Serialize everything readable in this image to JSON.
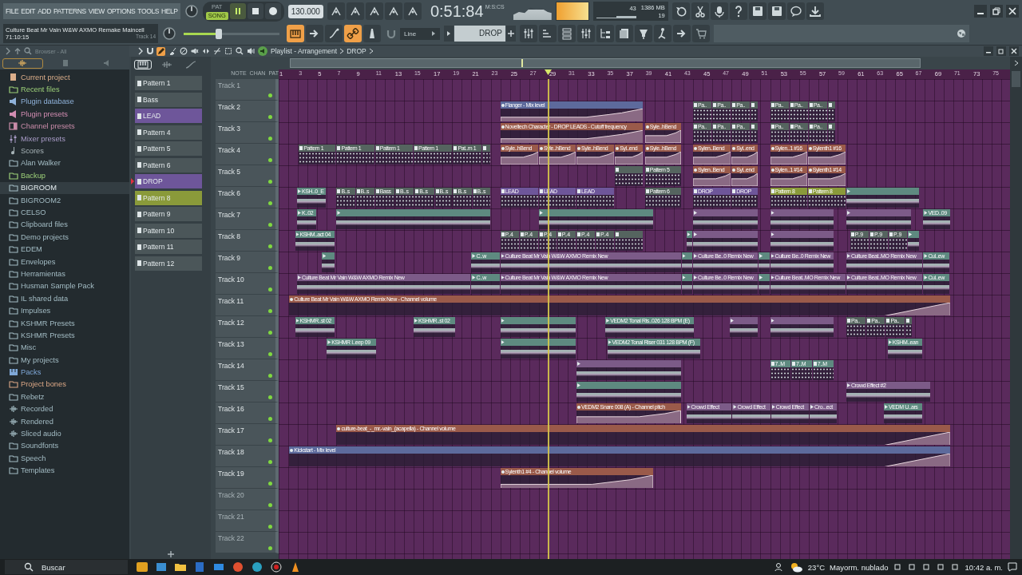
{
  "window": {
    "menu": [
      "FILE",
      "EDIT",
      "ADD",
      "PATTERNS",
      "VIEW",
      "OPTIONS",
      "TOOLS",
      "HELP"
    ],
    "project": {
      "title": "Culture Beat  Mr Vain W&W AXMO Remake Maincell",
      "time": "71:10:15",
      "hint": "Track 14"
    },
    "transport": {
      "modes": [
        {
          "label": "PAT",
          "selected": false
        },
        {
          "label": "SONG",
          "selected": true
        }
      ],
      "playing": true,
      "tempo": "130.000",
      "time": "0:51:84",
      "time_unit": "M:S:CS"
    },
    "meters": {
      "cpu": "43",
      "memory": "1386 MB",
      "polyphony": "19"
    },
    "master_volume": {
      "level": 0.37
    },
    "snap": "Line",
    "pattern": "DROP",
    "toggles": [
      {
        "kind": "playlist",
        "on": true
      },
      {
        "kind": "arrow",
        "on": false
      },
      {
        "kind": "curve",
        "on": false
      },
      {
        "kind": "link",
        "on": true
      },
      {
        "kind": "metronome",
        "on": false
      }
    ]
  },
  "browser": {
    "title": "Browser - All",
    "tabs": [
      {
        "kind": "all",
        "selected": true
      },
      {
        "kind": "files",
        "selected": false
      },
      {
        "kind": "plugins",
        "selected": false
      }
    ],
    "items": [
      {
        "label": "Current project",
        "kind": "project",
        "selected": false
      },
      {
        "label": "Recent files",
        "kind": "recent",
        "selected": false
      },
      {
        "label": "Plugin database",
        "kind": "plugin",
        "selected": false
      },
      {
        "label": "Plugin presets",
        "kind": "plugin_presets",
        "selected": false
      },
      {
        "label": "Channel presets",
        "kind": "channel",
        "selected": false
      },
      {
        "label": "Mixer presets",
        "kind": "mixer",
        "selected": false
      },
      {
        "label": "Scores",
        "kind": "scores",
        "selected": false
      },
      {
        "label": "Alan Walker",
        "kind": "folder",
        "selected": false
      },
      {
        "label": "Backup",
        "kind": "recent",
        "selected": false
      },
      {
        "label": "BIGROOM",
        "kind": "folder",
        "selected": true
      },
      {
        "label": "BIGROOM2",
        "kind": "folder",
        "selected": false
      },
      {
        "label": "CELSO",
        "kind": "folder",
        "selected": false
      },
      {
        "label": "Clipboard files",
        "kind": "folder",
        "selected": false
      },
      {
        "label": "Demo projects",
        "kind": "folder",
        "selected": false
      },
      {
        "label": "EDEM",
        "kind": "folder",
        "selected": false
      },
      {
        "label": "Envelopes",
        "kind": "folder",
        "selected": false
      },
      {
        "label": "Herramientas",
        "kind": "folder",
        "selected": false
      },
      {
        "label": "Husman Sample Pack",
        "kind": "folder",
        "selected": false
      },
      {
        "label": "IL shared data",
        "kind": "folder",
        "selected": false
      },
      {
        "label": "Impulses",
        "kind": "folder",
        "selected": false
      },
      {
        "label": "KSHMR Presets",
        "kind": "folder",
        "selected": false
      },
      {
        "label": "KSHMR Presets",
        "kind": "folder",
        "selected": false
      },
      {
        "label": "Misc",
        "kind": "folder",
        "selected": false
      },
      {
        "label": "My projects",
        "kind": "folder",
        "selected": false
      },
      {
        "label": "Packs",
        "kind": "packs",
        "selected": false
      },
      {
        "label": "Project bones",
        "kind": "bones",
        "selected": false
      },
      {
        "label": "Rebetz",
        "kind": "folder",
        "selected": false
      },
      {
        "label": "Recorded",
        "kind": "audio",
        "selected": false
      },
      {
        "label": "Rendered",
        "kind": "audio",
        "selected": false
      },
      {
        "label": "Sliced audio",
        "kind": "audio",
        "selected": false
      },
      {
        "label": "Soundfonts",
        "kind": "folder",
        "selected": false
      },
      {
        "label": "Speech",
        "kind": "folder",
        "selected": false
      },
      {
        "label": "Templates",
        "kind": "folder",
        "selected": false
      }
    ]
  },
  "playlist": {
    "title": "Playlist - Arrangement",
    "pattern": "DROP",
    "tools": [
      {
        "kind": "draw",
        "selected": true
      },
      {
        "kind": "paint",
        "selected": false
      },
      {
        "kind": "delete",
        "selected": false
      },
      {
        "kind": "mute",
        "selected": false
      },
      {
        "kind": "slip",
        "selected": false
      },
      {
        "kind": "slice",
        "selected": false
      },
      {
        "kind": "select",
        "selected": false
      },
      {
        "kind": "zoom",
        "selected": false
      },
      {
        "kind": "playback",
        "selected": false
      }
    ],
    "picker_tabs": [
      {
        "kind": "patterns",
        "selected": true
      },
      {
        "kind": "audio",
        "selected": false
      },
      {
        "kind": "automation",
        "selected": false
      }
    ],
    "header_tabs": [
      "NOTE",
      "CHAN",
      "PAT"
    ],
    "ruler": [
      "1",
      "3",
      "5",
      "7",
      "9",
      "11",
      "13",
      "15",
      "17",
      "19",
      "21",
      "23",
      "25",
      "27",
      "29",
      "31",
      "33",
      "35",
      "37",
      "39",
      "41",
      "43",
      "45",
      "47",
      "49",
      "51",
      "53",
      "55",
      "57",
      "59",
      "61",
      "63",
      "65",
      "67",
      "69",
      "71",
      "73",
      "75"
    ],
    "patterns": [
      {
        "label": "Pattern 1",
        "color": "#4b5659",
        "selected": false
      },
      {
        "label": "Bass",
        "color": "#4b5659",
        "selected": false
      },
      {
        "label": "LEAD",
        "color": "#6e569a",
        "selected": false
      },
      {
        "label": "Pattern 4",
        "color": "#4b5659",
        "selected": false
      },
      {
        "label": "Pattern 5",
        "color": "#4b5659",
        "selected": false
      },
      {
        "label": "Pattern 6",
        "color": "#4b5659",
        "selected": false
      },
      {
        "label": "DROP",
        "color": "#6e569a",
        "selected": true
      },
      {
        "label": "Pattern 8",
        "color": "#8a9a3a",
        "selected": false
      },
      {
        "label": "Pattern 9",
        "color": "#4b5659",
        "selected": false
      },
      {
        "label": "Pattern 10",
        "color": "#4b5659",
        "selected": false
      },
      {
        "label": "Pattern 11",
        "color": "#4b5659",
        "selected": false
      },
      {
        "label": "Pattern 12",
        "color": "#4b5659",
        "selected": false
      }
    ],
    "tracks": [
      {
        "name": "Track 1",
        "empty": true,
        "active": true
      },
      {
        "name": "Track 2",
        "empty": false,
        "active": true,
        "clips": [
          {
            "kind": "auto",
            "label": "Flanger - Mix level",
            "color": "#5d6a9c"
          },
          {
            "kind": "pattern",
            "label": "Pa..",
            "color": "#55645f"
          },
          {
            "kind": "pattern",
            "label": "Pa..",
            "color": "#55645f"
          },
          {
            "kind": "pattern",
            "label": "Pa..",
            "color": "#55645f"
          },
          {
            "kind": "pattern",
            "color": "#55645f"
          },
          {
            "kind": "pattern",
            "label": "Pa..",
            "color": "#55645f"
          },
          {
            "kind": "pattern",
            "label": "Pa..",
            "color": "#55645f"
          },
          {
            "kind": "pattern",
            "label": "Pa..",
            "color": "#55645f"
          },
          {
            "kind": "pattern",
            "color": "#55645f"
          }
        ]
      },
      {
        "name": "Track 3",
        "empty": false,
        "active": true,
        "clips": [
          {
            "kind": "auto",
            "label": "Noveltech Character - DROP  LEADS - Cutoff frequency",
            "color": "#9a5a4a"
          },
          {
            "kind": "auto",
            "label": "Syle..hBend",
            "color": "#9a5a4a"
          },
          {
            "kind": "pattern",
            "label": "Pa..",
            "color": "#55645f"
          },
          {
            "kind": "pattern",
            "label": "Pa..",
            "color": "#55645f"
          },
          {
            "kind": "pattern",
            "label": "Pa..",
            "color": "#55645f"
          },
          {
            "kind": "pattern",
            "color": "#55645f"
          },
          {
            "kind": "pattern",
            "label": "Pa..",
            "color": "#55645f"
          },
          {
            "kind": "pattern",
            "label": "Pa..",
            "color": "#55645f"
          },
          {
            "kind": "pattern",
            "label": "Pa..",
            "color": "#55645f"
          },
          {
            "kind": "pattern",
            "color": "#55645f"
          }
        ]
      },
      {
        "name": "Track 4",
        "empty": false,
        "active": true,
        "clips": [
          {
            "kind": "pattern",
            "label": "Pattern 1",
            "color": "#55645f"
          },
          {
            "kind": "pattern",
            "label": "Pattern 1",
            "color": "#55645f"
          },
          {
            "kind": "pattern",
            "label": "Pattern 1",
            "color": "#55645f"
          },
          {
            "kind": "pattern",
            "label": "Pattern 1",
            "color": "#55645f"
          },
          {
            "kind": "pattern",
            "label": "Pat..rn 1",
            "color": "#55645f"
          },
          {
            "kind": "pattern",
            "color": "#55645f"
          },
          {
            "kind": "auto",
            "label": "Syle..hBend",
            "color": "#9a5a4a"
          },
          {
            "kind": "auto",
            "label": "Syle..hBend",
            "color": "#9a5a4a"
          },
          {
            "kind": "auto",
            "label": "Syle..hBend",
            "color": "#9a5a4a"
          },
          {
            "kind": "auto",
            "label": "Syl..end",
            "color": "#9a5a4a"
          },
          {
            "kind": "auto",
            "label": "Syle..hBend",
            "color": "#9a5a4a"
          },
          {
            "kind": "auto",
            "label": "Sylen..Bend",
            "color": "#9a5a4a"
          },
          {
            "kind": "auto",
            "label": "Syl..end",
            "color": "#9a5a4a"
          },
          {
            "kind": "auto",
            "label": "Sylen..1 #16",
            "color": "#9a5a4a"
          },
          {
            "kind": "auto",
            "label": "Sylenth1 #16",
            "color": "#9a5a4a"
          }
        ]
      },
      {
        "name": "Track 5",
        "empty": false,
        "active": true,
        "clips": [
          {
            "kind": "pattern",
            "color": "#55645f"
          },
          {
            "kind": "pattern",
            "label": "Pattern 5",
            "color": "#55645f"
          },
          {
            "kind": "auto",
            "label": "Sylen..Bend",
            "color": "#9a5a4a"
          },
          {
            "kind": "auto",
            "label": "Syl..end",
            "color": "#9a5a4a"
          },
          {
            "kind": "auto",
            "label": "Sylen..1 #14",
            "color": "#9a5a4a"
          },
          {
            "kind": "auto",
            "label": "Sylenth1 #14",
            "color": "#9a5a4a"
          }
        ]
      },
      {
        "name": "Track 6",
        "empty": false,
        "active": true,
        "clips": [
          {
            "kind": "audio",
            "label": "KSH..0_E",
            "color": "#5e8a80"
          },
          {
            "kind": "pattern",
            "label": "B..s",
            "color": "#55645f"
          },
          {
            "kind": "pattern",
            "label": "B..s",
            "color": "#55645f"
          },
          {
            "kind": "pattern",
            "label": "Bass",
            "color": "#55645f"
          },
          {
            "kind": "pattern",
            "label": "B..s",
            "color": "#55645f"
          },
          {
            "kind": "pattern",
            "label": "B..s",
            "color": "#55645f"
          },
          {
            "kind": "pattern",
            "label": "B..s",
            "color": "#55645f"
          },
          {
            "kind": "pattern",
            "label": "B..s",
            "color": "#55645f"
          },
          {
            "kind": "pattern",
            "label": "B..s",
            "color": "#55645f"
          },
          {
            "kind": "pattern",
            "label": "LEAD",
            "color": "#6e569a"
          },
          {
            "kind": "pattern",
            "label": "LEAD",
            "color": "#6e569a"
          },
          {
            "kind": "pattern",
            "label": "LEAD",
            "color": "#6e569a"
          },
          {
            "kind": "pattern",
            "label": "Pattern 6",
            "color": "#55645f"
          },
          {
            "kind": "pattern",
            "label": "DROP",
            "color": "#6e569a"
          },
          {
            "kind": "pattern",
            "label": "DROP",
            "color": "#6e569a"
          },
          {
            "kind": "pattern",
            "label": "Pattern 8",
            "color": "#8a9a3a"
          },
          {
            "kind": "pattern",
            "label": "Pattern 8",
            "color": "#8a9a3a"
          },
          {
            "kind": "audio",
            "color": "#5e8a80"
          }
        ]
      },
      {
        "name": "Track 7",
        "empty": false,
        "active": true,
        "clips": [
          {
            "kind": "audio",
            "label": "K..02",
            "color": "#5e8a80"
          },
          {
            "kind": "audio",
            "color": "#5e8a80"
          },
          {
            "kind": "audio",
            "color": "#5e8a80"
          },
          {
            "kind": "audio",
            "color": "#7c5b88"
          },
          {
            "kind": "audio",
            "color": "#7c5b88"
          },
          {
            "kind": "audio",
            "color": "#7c5b88"
          },
          {
            "kind": "audio",
            "label": "VED..09",
            "color": "#5e8a80"
          }
        ]
      },
      {
        "name": "Track 8",
        "empty": false,
        "active": true,
        "clips": [
          {
            "kind": "audio",
            "label": "KSHM..act 04",
            "color": "#5e8a80"
          },
          {
            "kind": "pattern",
            "label": "P..4",
            "color": "#55645f"
          },
          {
            "kind": "pattern",
            "label": "P..4",
            "color": "#55645f"
          },
          {
            "kind": "pattern",
            "label": "P..4",
            "color": "#55645f"
          },
          {
            "kind": "pattern",
            "label": "P..4",
            "color": "#55645f"
          },
          {
            "kind": "pattern",
            "label": "P..4",
            "color": "#55645f"
          },
          {
            "kind": "pattern",
            "label": "P..4",
            "color": "#55645f"
          },
          {
            "kind": "pattern",
            "color": "#55645f"
          },
          {
            "kind": "audio",
            "color": "#5e8a80"
          },
          {
            "kind": "audio",
            "color": "#7c5b88"
          },
          {
            "kind": "audio",
            "color": "#7c5b88"
          },
          {
            "kind": "pattern",
            "label": "P..9",
            "color": "#55645f"
          },
          {
            "kind": "pattern",
            "label": "P..9",
            "color": "#55645f"
          },
          {
            "kind": "pattern",
            "label": "P..9",
            "color": "#55645f"
          },
          {
            "kind": "audio",
            "color": "#5e8a80"
          }
        ]
      },
      {
        "name": "Track 9",
        "empty": false,
        "active": true,
        "clips": [
          {
            "kind": "audio",
            "color": "#5e8a80"
          },
          {
            "kind": "audio",
            "label": "C..w",
            "color": "#5e8a80"
          },
          {
            "kind": "audio",
            "label": "Culture Beat  Mr Vain W&W  AXMO Remix New",
            "color": "#7c5b88"
          },
          {
            "kind": "audio",
            "color": "#5e8a80"
          },
          {
            "kind": "audio",
            "label": "Culture Be..0 Remix New",
            "color": "#7c5b88"
          },
          {
            "kind": "audio",
            "color": "#5e8a80"
          },
          {
            "kind": "audio",
            "label": "Culture Be..0 Remix New",
            "color": "#7c5b88"
          },
          {
            "kind": "audio",
            "label": "Culture Beat..MO Remix New",
            "color": "#7c5b88"
          },
          {
            "kind": "audio",
            "label": "Cul..ew",
            "color": "#5e8a80"
          }
        ]
      },
      {
        "name": "Track 10",
        "empty": false,
        "active": true,
        "clips": [
          {
            "kind": "audio",
            "label": "Culture Beat  Mr Vain W&W  AXMO Remix New",
            "color": "#7c5b88"
          },
          {
            "kind": "audio",
            "label": "C..w",
            "color": "#5e8a80"
          },
          {
            "kind": "audio",
            "label": "Culture Beat  Mr Vain W&W  AXMO Remix New",
            "color": "#7c5b88"
          },
          {
            "kind": "audio",
            "color": "#5e8a80"
          },
          {
            "kind": "audio",
            "label": "Culture Be..0 Remix New",
            "color": "#7c5b88"
          },
          {
            "kind": "audio",
            "color": "#5e8a80"
          },
          {
            "kind": "audio",
            "label": "Culture Beat..MO Remix New",
            "color": "#7c5b88"
          },
          {
            "kind": "audio",
            "label": "Culture Beat..MO Remix New",
            "color": "#7c5b88"
          },
          {
            "kind": "audio",
            "label": "Cul..ew",
            "color": "#5e8a80"
          }
        ]
      },
      {
        "name": "Track 11",
        "empty": false,
        "active": true,
        "clips": [
          {
            "kind": "auto",
            "label": "Culture Beat  Mr Vain W&W  AXMO Remix New - Channel volume",
            "color": "#9a5a4a"
          }
        ]
      },
      {
        "name": "Track 12",
        "empty": false,
        "active": true,
        "clips": [
          {
            "kind": "audio",
            "label": "KSHMR..st 02",
            "color": "#5e8a80"
          },
          {
            "kind": "audio",
            "label": "KSHMR..st 02",
            "color": "#5e8a80"
          },
          {
            "kind": "audio",
            "color": "#5e8a80"
          },
          {
            "kind": "audio",
            "label": "VEDM2 Tonal Ris..026 128 BPM (E)",
            "color": "#5e8a80"
          },
          {
            "kind": "audio",
            "color": "#7c5b88"
          },
          {
            "kind": "audio",
            "color": "#7c5b88"
          },
          {
            "kind": "pattern",
            "label": "Pa..",
            "color": "#55645f"
          },
          {
            "kind": "pattern",
            "label": "Pa..",
            "color": "#55645f"
          },
          {
            "kind": "pattern",
            "label": "Pa..",
            "color": "#55645f"
          },
          {
            "kind": "pattern",
            "color": "#55645f"
          }
        ]
      },
      {
        "name": "Track 13",
        "empty": false,
        "active": true,
        "clips": [
          {
            "kind": "audio",
            "label": "KSHMR I..eep 09",
            "color": "#5e8a80"
          },
          {
            "kind": "audio",
            "color": "#5e8a80"
          },
          {
            "kind": "audio",
            "label": "VEDM2 Tonal Riser 031 128 BPM (F)",
            "color": "#5e8a80"
          },
          {
            "kind": "audio",
            "label": "KSHM..ean",
            "color": "#5e8a80"
          }
        ]
      },
      {
        "name": "Track 14",
        "empty": false,
        "active": true,
        "clips": [
          {
            "kind": "audio",
            "color": "#7c5b88"
          },
          {
            "kind": "pattern",
            "label": "7..M",
            "color": "#5e8a80"
          },
          {
            "kind": "pattern",
            "label": "7..M",
            "color": "#5e8a80"
          },
          {
            "kind": "pattern",
            "label": "7..M",
            "color": "#5e8a80"
          }
        ]
      },
      {
        "name": "Track 15",
        "empty": false,
        "active": true,
        "clips": [
          {
            "kind": "audio",
            "color": "#5e8a80"
          },
          {
            "kind": "audio",
            "label": "Crowd Effect #2",
            "color": "#7c5b88"
          }
        ]
      },
      {
        "name": "Track 16",
        "empty": false,
        "active": true,
        "clips": [
          {
            "kind": "auto",
            "label": "VEDM2 Snare 008 (A) - Channel pitch",
            "color": "#9a5a4a"
          },
          {
            "kind": "audio",
            "label": "Crowd Effect",
            "color": "#7c5b88"
          },
          {
            "kind": "audio",
            "label": "Crowd Effect",
            "color": "#7c5b88"
          },
          {
            "kind": "audio",
            "label": "Crowd Effect",
            "color": "#7c5b88"
          },
          {
            "kind": "audio",
            "label": "Cro...ect",
            "color": "#7c5b88"
          },
          {
            "kind": "audio",
            "label": "VEDM U..ars",
            "color": "#5e8a80"
          }
        ]
      },
      {
        "name": "Track 17",
        "empty": false,
        "active": true,
        "clips": [
          {
            "kind": "auto",
            "label": "culture-beat_-_mr.-vain_(acapella) - Channel volume",
            "color": "#9a5a4a"
          }
        ]
      },
      {
        "name": "Track 18",
        "empty": false,
        "active": true,
        "clips": [
          {
            "kind": "auto",
            "label": "Kickstart - Mix level",
            "color": "#5d6a9c"
          }
        ]
      },
      {
        "name": "Track 19",
        "empty": false,
        "active": true,
        "clips": [
          {
            "kind": "auto",
            "label": "Sylenth1 #4 - Channel volume",
            "color": "#9a5a4a"
          }
        ]
      },
      {
        "name": "Track 20",
        "empty": true,
        "active": true
      },
      {
        "name": "Track 21",
        "empty": true,
        "active": true
      },
      {
        "name": "Track 22",
        "empty": true,
        "active": true
      }
    ]
  },
  "taskbar": {
    "search": "Buscar",
    "temperature": "23°C",
    "forecast": "Mayorm. nublado",
    "clock": "10:42 a. m."
  }
}
